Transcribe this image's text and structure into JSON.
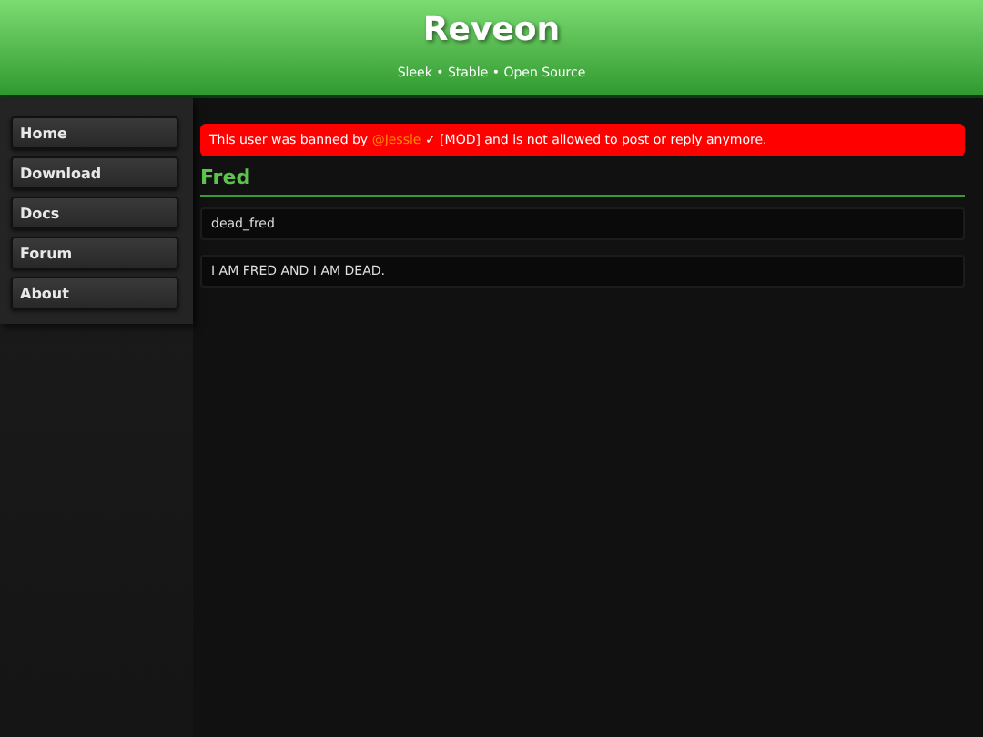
{
  "header": {
    "title": "Reveon",
    "tagline": "Sleek • Stable • Open Source"
  },
  "nav": [
    {
      "label": "Home"
    },
    {
      "label": "Download"
    },
    {
      "label": "Docs"
    },
    {
      "label": "Forum"
    },
    {
      "label": "About"
    }
  ],
  "ban_notice": {
    "prefix": "This user was banned by",
    "moderator": "@Jessie",
    "suffix": "✓ [MOD] and is not allowed to post or reply anymore."
  },
  "profile": {
    "name": "Fred",
    "fields": [
      "dead_fred",
      "I AM FRED AND I AM DEAD."
    ]
  }
}
